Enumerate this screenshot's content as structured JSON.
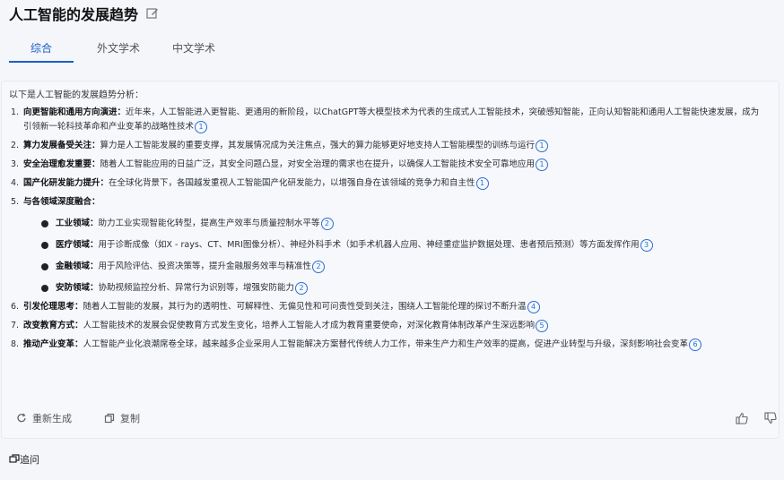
{
  "header": {
    "title": "人工智能的发展趋势"
  },
  "tabs": [
    "综合",
    "外文学术",
    "中文学术"
  ],
  "content": {
    "intro": "以下是人工智能的发展趋势分析：",
    "items": [
      {
        "num": "1.",
        "title": "向更智能和通用方向演进：",
        "text": "近年来，人工智能进入更智能、更通用的新阶段，以ChatGPT等大模型技术为代表的生成式人工智能技术，突破感知智能，正向认知智能和通用人工智能快速发展，成为引领新一轮科技革命和产业变革的战略性技术",
        "cite": "1"
      },
      {
        "num": "2.",
        "title": "算力发展备受关注：",
        "text": "算力是人工智能发展的重要支撑，其发展情况成为关注焦点，强大的算力能够更好地支持人工智能模型的训练与运行",
        "cite": "1"
      },
      {
        "num": "3.",
        "title": "安全治理愈发重要：",
        "text": "随着人工智能应用的日益广泛，其安全问题凸显，对安全治理的需求也在提升，以确保人工智能技术安全可靠地应用",
        "cite": "1"
      },
      {
        "num": "4.",
        "title": "国产化研发能力提升：",
        "text": "在全球化背景下，各国越发重视人工智能国产化研发能力，以增强自身在该领域的竞争力和自主性",
        "cite": "1"
      },
      {
        "num": "5.",
        "title": "与各领域深度融合：",
        "text": "",
        "cite": ""
      },
      {
        "num": "6.",
        "title": "引发伦理思考：",
        "text": "随着人工智能的发展，其行为的透明性、可解释性、无偏见性和可问责性受到关注，围绕人工智能伦理的探讨不断升温",
        "cite": "4"
      },
      {
        "num": "7.",
        "title": "改变教育方式：",
        "text": "人工智能技术的发展会促使教育方式发生变化，培养人工智能人才成为教育重要使命，对深化教育体制改革产生深远影响",
        "cite": "5"
      },
      {
        "num": "8.",
        "title": "推动产业变革：",
        "text": "人工智能产业化浪潮席卷全球，越来越多企业采用人工智能解决方案替代传统人力工作，带来生产力和生产效率的提高，促进产业转型与升级，深刻影响社会变革",
        "cite": "6"
      }
    ],
    "subitems": [
      {
        "title": "工业领域：",
        "text": "助力工业实现智能化转型，提高生产效率与质量控制水平等",
        "cite": "2"
      },
      {
        "title": "医疗领域：",
        "text": "用于诊断成像（如X - rays、CT、MRI图像分析）、神经外科手术（如手术机器人应用、神经重症监护数据处理、患者预后预测）等方面发挥作用",
        "cite": "3"
      },
      {
        "title": "金融领域：",
        "text": "用于风险评估、投资决策等，提升金融服务效率与精准性",
        "cite": "2"
      },
      {
        "title": "安防领域：",
        "text": "协助视频监控分析、异常行为识别等，增强安防能力",
        "cite": "2"
      }
    ]
  },
  "actions": {
    "regenerate": "重新生成",
    "copy": "复制"
  },
  "followup": {
    "label": "追问"
  },
  "colors": {
    "accent": "#1a5fc7",
    "panel": "#f6f8fc"
  }
}
